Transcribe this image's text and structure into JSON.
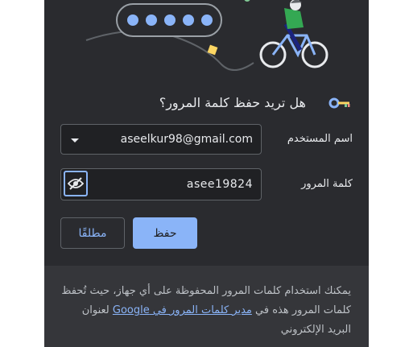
{
  "dialog": {
    "title": "هل تريد حفظ كلمة المرور؟",
    "username_label": "اسم المستخدم",
    "username_value": "aseelkur98@gmail.com",
    "password_label": "كلمة المرور",
    "password_value": "asee19824",
    "save_button": "حفظ",
    "never_button": "مطلقًا"
  },
  "footer": {
    "text_before": "يمكنك استخدام كلمات المرور المحفوظة على أي جهاز، حيث تُحفظ كلمات المرور هذه في ",
    "link_text": "مدير كلمات المرور في Google",
    "text_after": " لعنوان البريد الإلكتروني"
  },
  "icons": {
    "key": "key-icon",
    "eye": "eye-off-icon",
    "caret": "chevron-down-icon"
  },
  "colors": {
    "background": "#2a2b2f",
    "accent": "#8ab4f8",
    "footer": "#35363a"
  }
}
